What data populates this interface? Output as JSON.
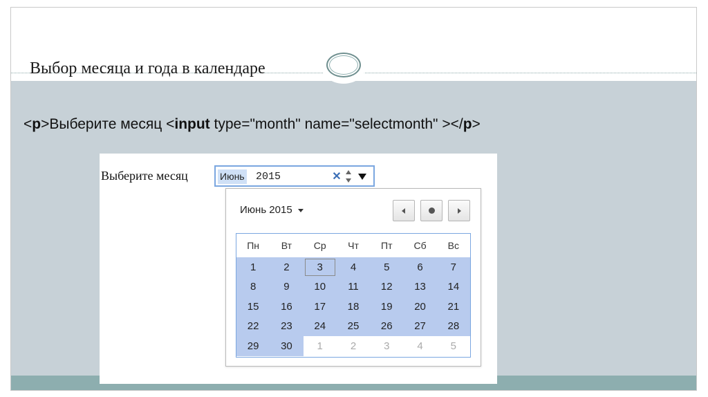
{
  "slide": {
    "title": "Выбор месяца и года в календаре",
    "code": {
      "lt1": "<",
      "tag_p": "p",
      "text1": ">Выберите месяц <",
      "tag_input": "input",
      "attrs": " type=\"month\" name=\"selectmonth\" ></",
      "tag_p2": "p",
      "gt": ">"
    }
  },
  "demo": {
    "label": "Выберите месяц",
    "input": {
      "month": "Июнь",
      "year": "2015",
      "clear_glyph": "✕"
    },
    "popup": {
      "month_year": "Июнь 2015",
      "weekdays": [
        "Пн",
        "Вт",
        "Ср",
        "Чт",
        "Пт",
        "Сб",
        "Вс"
      ],
      "weeks": [
        [
          "1",
          "2",
          "3",
          "4",
          "5",
          "6",
          "7"
        ],
        [
          "8",
          "9",
          "10",
          "11",
          "12",
          "13",
          "14"
        ],
        [
          "15",
          "16",
          "17",
          "18",
          "19",
          "20",
          "21"
        ],
        [
          "22",
          "23",
          "24",
          "25",
          "26",
          "27",
          "28"
        ],
        [
          "29",
          "30",
          "1",
          "2",
          "3",
          "4",
          "5"
        ]
      ],
      "selected_day": "3"
    }
  },
  "colors": {
    "band": "#c7d1d7",
    "bottom_band": "#8daeaf",
    "month_highlight": "#b8cbee",
    "input_border": "#7aa6e0"
  }
}
